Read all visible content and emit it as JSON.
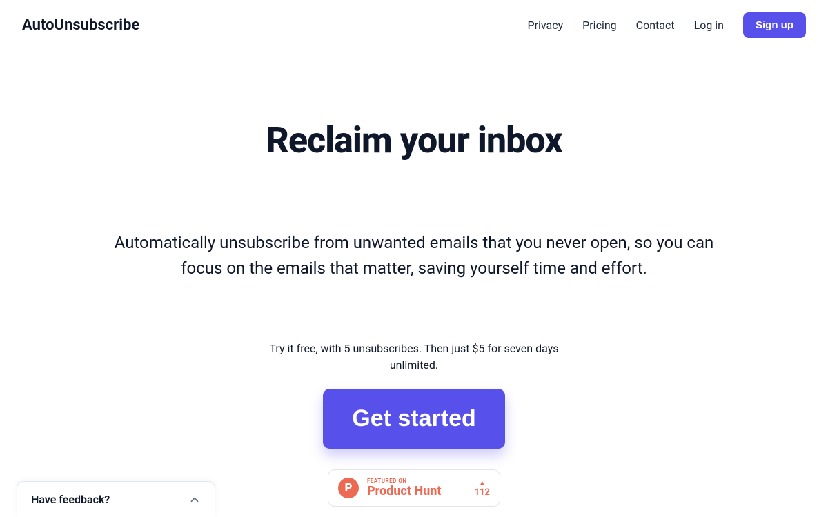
{
  "brand": "AutoUnsubscribe",
  "nav": {
    "privacy": "Privacy",
    "pricing": "Pricing",
    "contact": "Contact",
    "login": "Log in",
    "signup": "Sign up"
  },
  "hero": {
    "title": "Reclaim your inbox",
    "subtitle": "Automatically unsubscribe from unwanted emails that you never open, so you can focus on the emails that matter, saving yourself time and effort.",
    "pricing_note": "Try it free, with 5 unsubscribes. Then just $5 for seven days unlimited.",
    "cta": "Get started"
  },
  "product_hunt": {
    "featured_label": "FEATURED ON",
    "name": "Product Hunt",
    "votes": "112",
    "logo_letter": "P"
  },
  "feedback": {
    "label": "Have feedback?"
  }
}
